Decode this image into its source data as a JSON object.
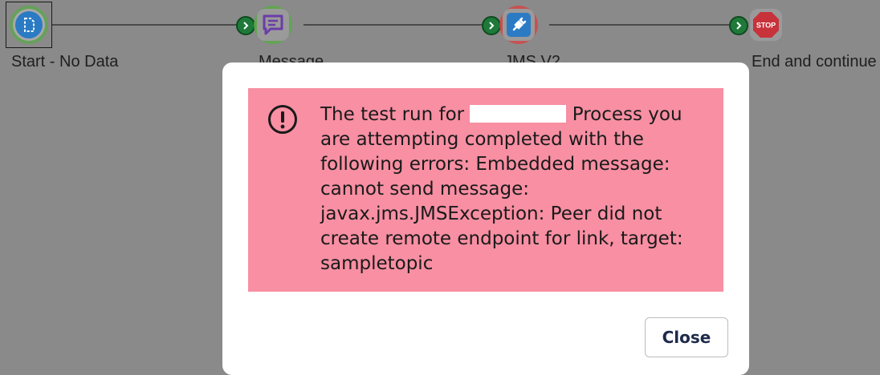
{
  "process": {
    "shapes": [
      {
        "label": "Start - No Data",
        "icon": "document-icon",
        "status_color": "#5aa84a"
      },
      {
        "label": "Message",
        "icon": "message-icon",
        "status_color": "#5aa84a"
      },
      {
        "label": "JMS V2",
        "icon": "plug-icon",
        "status_color": "#d04848"
      },
      {
        "label": "End and continue",
        "icon": "stop-sign-icon",
        "stop_text": "STOP"
      }
    ]
  },
  "dialog": {
    "message_before": "The test run for ",
    "message_after": " Process you are attempting completed with the following errors: Embedded message: cannot send message: javax.jms.JMSException: Peer did not create remote endpoint for link, target: sampletopic",
    "close_label": "Close",
    "alert_color": "#f88fa3"
  }
}
